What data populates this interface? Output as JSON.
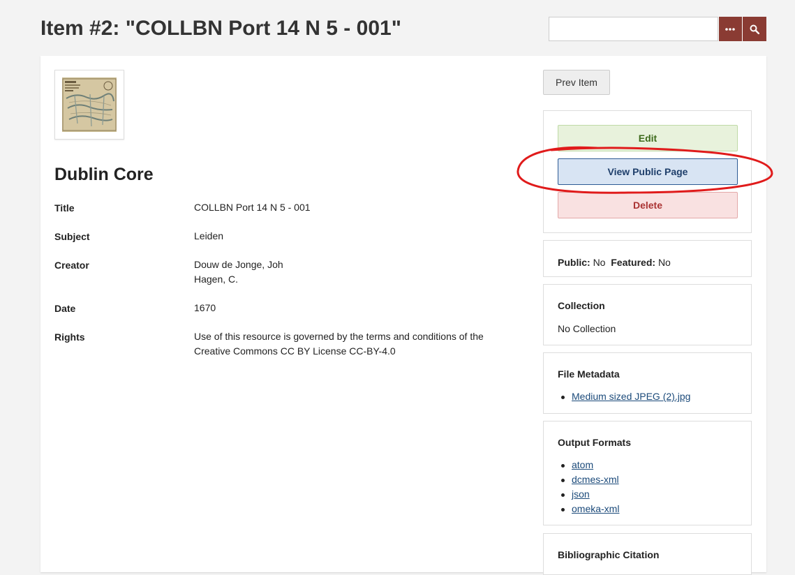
{
  "page": {
    "title": "Item #2: \"COLLBN Port 14 N 5 - 001\""
  },
  "search": {
    "value": "",
    "placeholder": ""
  },
  "icons": {
    "advanced_search": "ellipsis-icon",
    "search": "search-icon"
  },
  "item": {
    "thumbnail_alt": "map thumbnail",
    "section_heading": "Dublin Core",
    "elements": [
      {
        "label": "Title",
        "values": [
          "COLLBN Port 14 N 5 - 001"
        ]
      },
      {
        "label": "Subject",
        "values": [
          "Leiden"
        ]
      },
      {
        "label": "Creator",
        "values": [
          "Douw de Jonge, Joh",
          "Hagen, C."
        ]
      },
      {
        "label": "Date",
        "values": [
          "1670"
        ]
      },
      {
        "label": "Rights",
        "values": [
          "Use of this resource is governed by the terms and conditions of the Creative Commons CC BY License CC-BY-4.0"
        ]
      }
    ]
  },
  "sidebar": {
    "prev_item": "Prev Item",
    "actions": {
      "edit": "Edit",
      "view_public": "View Public Page",
      "delete": "Delete"
    },
    "status": {
      "public_label": "Public:",
      "public_value": "No",
      "featured_label": "Featured:",
      "featured_value": "No"
    },
    "collection": {
      "title": "Collection",
      "value": "No Collection"
    },
    "file_metadata": {
      "title": "File Metadata",
      "files": [
        "Medium sized JPEG (2).jpg"
      ]
    },
    "output_formats": {
      "title": "Output Formats",
      "formats": [
        "atom",
        "dcmes-xml",
        "json",
        "omeka-xml"
      ]
    },
    "citation": {
      "title": "Bibliographic Citation"
    }
  },
  "colors": {
    "accent": "#8a3b33",
    "annotation": "#e01b1b"
  }
}
